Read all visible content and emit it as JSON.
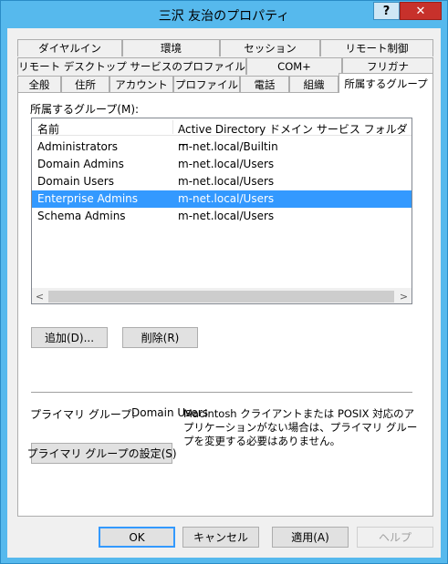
{
  "window": {
    "title": "三沢 友治のプロパティ",
    "help_label": "?",
    "close_label": "✕"
  },
  "tabs": {
    "row1": [
      "ダイヤルイン",
      "環境",
      "セッション",
      "リモート制御"
    ],
    "row2": [
      "リモート デスクトップ サービスのプロファイル",
      "COM+",
      "フリガナ"
    ],
    "row3": [
      "全般",
      "住所",
      "アカウント",
      "プロファイル",
      "電話",
      "組織",
      "所属するグループ"
    ],
    "active": "所属するグループ"
  },
  "groups": {
    "label": "所属するグループ(M):",
    "columns": [
      "名前",
      "Active Directory ドメイン サービス フォルダー"
    ],
    "rows": [
      [
        "Administrators",
        "m-net.local/Builtin"
      ],
      [
        "Domain Admins",
        "m-net.local/Users"
      ],
      [
        "Domain Users",
        "m-net.local/Users"
      ],
      [
        "Enterprise Admins",
        "m-net.local/Users"
      ],
      [
        "Schema Admins",
        "m-net.local/Users"
      ]
    ],
    "selected_index": 3
  },
  "scroll": {
    "left": "<",
    "right": ">"
  },
  "buttons": {
    "add": "追加(D)...",
    "remove": "削除(R)",
    "set_primary": "プライマリ グループの設定(S)",
    "ok": "OK",
    "cancel": "キャンセル",
    "apply": "適用(A)",
    "help": "ヘルプ"
  },
  "primary": {
    "label": "プライマリ グループ:",
    "value": "Domain Users",
    "note": "Macintosh クライアントまたは POSIX 対応のアプリケーションがない場合は、プライマリ グループを変更する必要はありません。"
  },
  "colors": {
    "titlebar": "#56b9ed",
    "close": "#c7312b",
    "selection": "#3399ff"
  }
}
